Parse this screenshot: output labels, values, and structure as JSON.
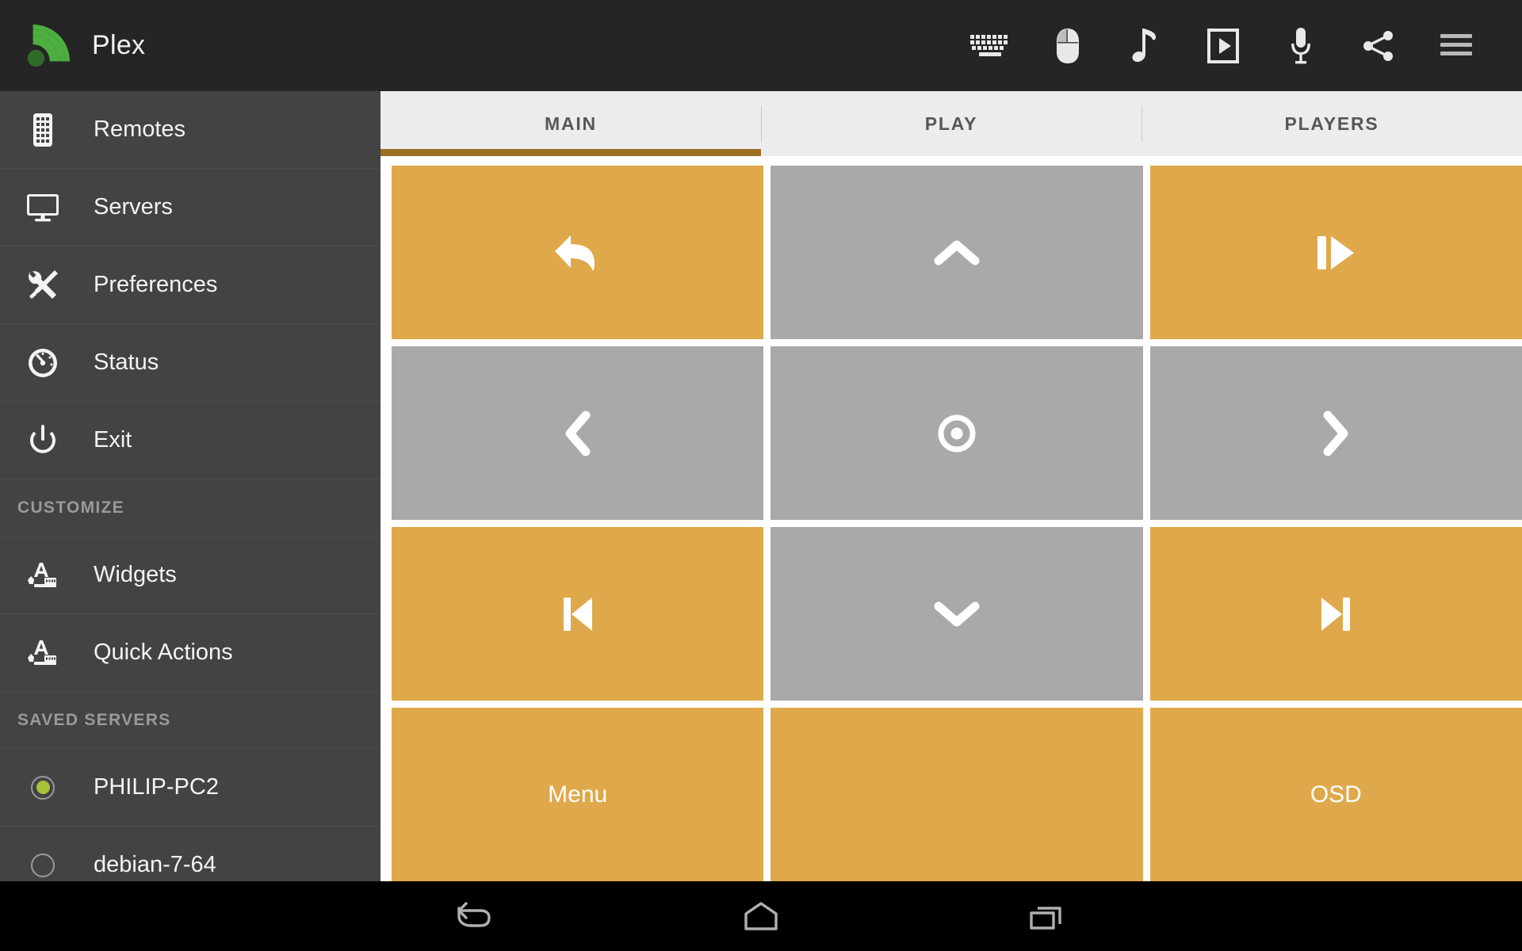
{
  "app": {
    "title": "Plex",
    "logo_icon": "signal-arc-logo",
    "logo_color": "#4caf3f"
  },
  "toolbar": {
    "items": [
      {
        "name": "keyboard-icon",
        "label": "Keyboard"
      },
      {
        "name": "mouse-icon",
        "label": "Mouse"
      },
      {
        "name": "music-note-icon",
        "label": "Music"
      },
      {
        "name": "video-icon",
        "label": "Video"
      },
      {
        "name": "microphone-icon",
        "label": "Voice"
      },
      {
        "name": "share-icon",
        "label": "Share"
      },
      {
        "name": "menu-icon",
        "label": "Menu"
      }
    ]
  },
  "sidebar": {
    "items": [
      {
        "label": "Remotes",
        "icon": "remote-control-icon"
      },
      {
        "label": "Servers",
        "icon": "monitor-icon"
      },
      {
        "label": "Preferences",
        "icon": "tools-icon"
      },
      {
        "label": "Status",
        "icon": "gauge-icon"
      },
      {
        "label": "Exit",
        "icon": "power-icon"
      }
    ],
    "customize_header": "CUSTOMIZE",
    "customize_items": [
      {
        "label": "Widgets",
        "icon": "widget-icon"
      },
      {
        "label": "Quick Actions",
        "icon": "widget-icon"
      }
    ],
    "servers_header": "SAVED SERVERS",
    "servers": [
      {
        "label": "PHILIP-PC2",
        "selected": true,
        "indicator_color": "#a8c23a"
      },
      {
        "label": "debian-7-64",
        "selected": false,
        "indicator_color": "#a8c23a"
      }
    ]
  },
  "content": {
    "tabs": [
      {
        "label": "MAIN",
        "active": true
      },
      {
        "label": "PLAY",
        "active": false
      },
      {
        "label": "PLAYERS",
        "active": false
      }
    ],
    "active_tab_underline_color": "#9a6f22",
    "buttons": [
      {
        "name": "back-button",
        "icon": "back-curved-arrow-icon",
        "label": "",
        "color": "orange"
      },
      {
        "name": "up-button",
        "icon": "chevron-up-icon",
        "label": "",
        "color": "gray"
      },
      {
        "name": "play-pause-button",
        "icon": "play-pause-icon",
        "label": "",
        "color": "orange"
      },
      {
        "name": "left-button",
        "icon": "chevron-left-icon",
        "label": "",
        "color": "gray"
      },
      {
        "name": "ok-button",
        "icon": "target-dot-icon",
        "label": "",
        "color": "gray"
      },
      {
        "name": "right-button",
        "icon": "chevron-right-icon",
        "label": "",
        "color": "gray"
      },
      {
        "name": "previous-button",
        "icon": "previous-track-icon",
        "label": "",
        "color": "orange"
      },
      {
        "name": "down-button",
        "icon": "chevron-down-icon",
        "label": "",
        "color": "gray"
      },
      {
        "name": "next-button",
        "icon": "next-track-icon",
        "label": "",
        "color": "orange"
      },
      {
        "name": "menu-button",
        "icon": "",
        "label": "Menu",
        "color": "orange"
      },
      {
        "name": "blank-button",
        "icon": "",
        "label": "",
        "color": "orange"
      },
      {
        "name": "osd-button",
        "icon": "",
        "label": "OSD",
        "color": "orange"
      }
    ],
    "button_colors": {
      "orange": "#dfa84b",
      "gray": "#a9a9a9"
    }
  },
  "android_nav": {
    "items": [
      {
        "name": "android-back-icon",
        "label": "Back"
      },
      {
        "name": "android-home-icon",
        "label": "Home"
      },
      {
        "name": "android-recents-icon",
        "label": "Recents"
      }
    ]
  }
}
